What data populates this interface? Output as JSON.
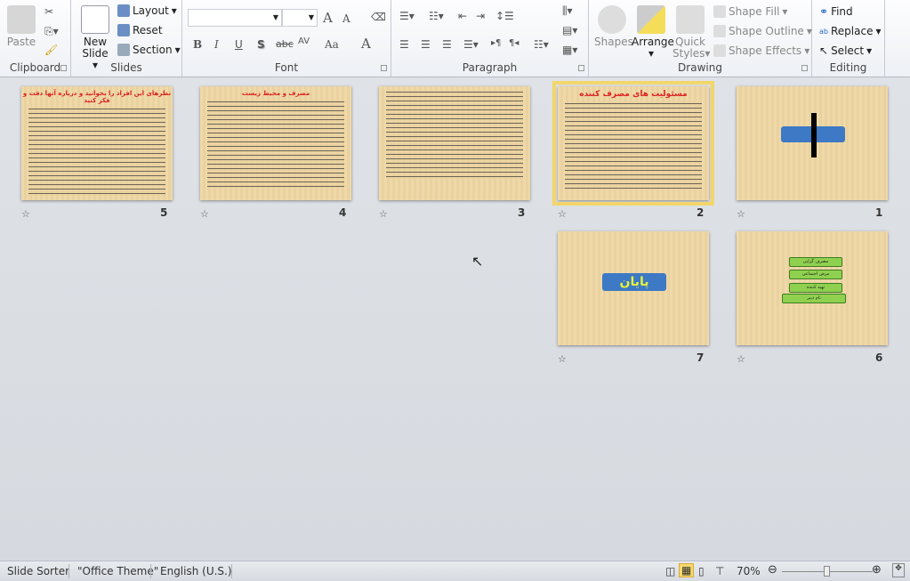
{
  "ribbon": {
    "clipboard": {
      "label": "Clipboard",
      "paste": "Paste"
    },
    "slides": {
      "label": "Slides",
      "new_slide": "New",
      "new_slide2": "Slide",
      "layout": "Layout",
      "reset": "Reset",
      "section": "Section"
    },
    "font": {
      "label": "Font",
      "font_name": "",
      "font_size": "",
      "bold": "B",
      "italic": "I",
      "underline": "U",
      "shadow": "S",
      "strike": "abc",
      "spacing": "AV",
      "case": "Aa",
      "grow": "A",
      "shrink": "A",
      "color": "A"
    },
    "paragraph": {
      "label": "Paragraph"
    },
    "drawing": {
      "label": "Drawing",
      "shapes": "Shapes",
      "arrange": "Arrange",
      "quick_styles": "Quick",
      "quick_styles2": "Styles",
      "shape_fill": "Shape Fill",
      "shape_outline": "Shape Outline",
      "shape_effects": "Shape Effects"
    },
    "editing": {
      "label": "Editing",
      "find": "Find",
      "replace": "Replace",
      "select": "Select"
    }
  },
  "slides": [
    {
      "number": "1",
      "kind": "shape"
    },
    {
      "number": "2",
      "title": "مسئولیت های مصرف کننده",
      "selected": true
    },
    {
      "number": "3",
      "title": ""
    },
    {
      "number": "4",
      "title": "مصرف و محیط زیست"
    },
    {
      "number": "5",
      "title": "نظرهای این افراد را بخوانید و درباره آنها دقت و فکر کنید"
    },
    {
      "number": "6",
      "boxes": [
        "مصرف گرایی",
        "مرض اجتماعی",
        "تهیه کننده",
        "نام دبیر"
      ]
    },
    {
      "number": "7",
      "title": "پایان"
    }
  ],
  "status": {
    "view": "Slide Sorter",
    "theme": "\"Office Theme\"",
    "language": "English (U.S.)",
    "zoom": "70%",
    "zoom_level": 0.5
  },
  "colors": {
    "selection": "#f3d66a",
    "slide_title": "#dd2222",
    "end_text": "#e8f23a",
    "button_blue": "#3d79c4"
  }
}
